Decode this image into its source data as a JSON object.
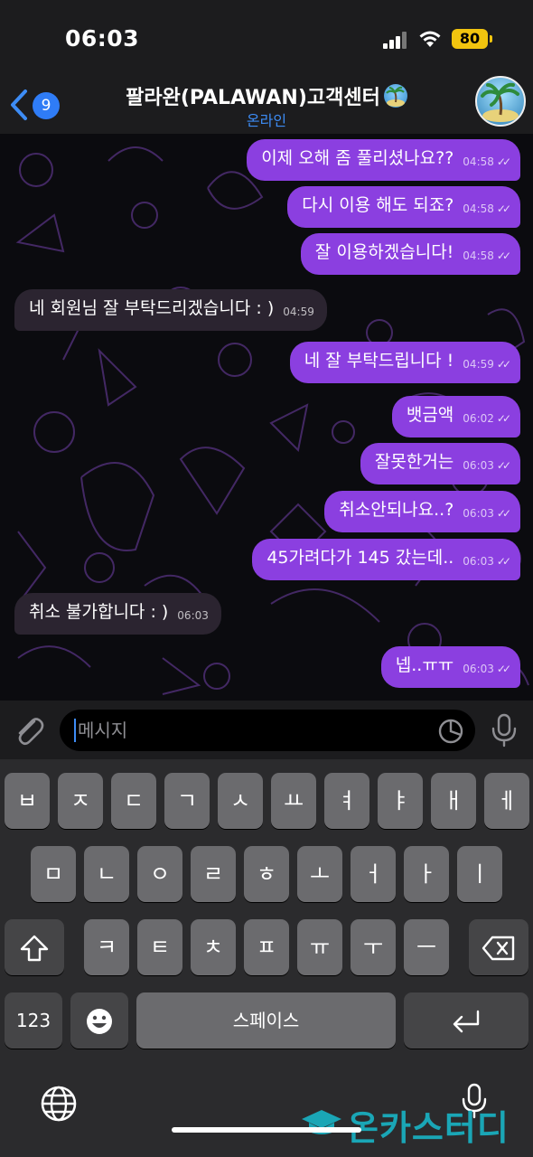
{
  "status_bar": {
    "time": "06:03",
    "battery": "80"
  },
  "header": {
    "back_count": "9",
    "title": "팔라완(PALAWAN)고객센터",
    "status": "온라인"
  },
  "messages": [
    {
      "dir": "out",
      "text": "이제 오해 좀 풀리셨나요??",
      "time": "04:58"
    },
    {
      "dir": "out",
      "text": "다시 이용 해도 되죠?",
      "time": "04:58"
    },
    {
      "dir": "out",
      "text": "잘 이용하겠습니다!",
      "time": "04:58"
    },
    {
      "dir": "in",
      "text": "네 회원님 잘 부탁드리겠습니다 : )",
      "time": "04:59"
    },
    {
      "dir": "out",
      "text": "네 잘 부탁드립니다 !",
      "time": "04:59"
    },
    {
      "dir": "out",
      "text": "뱃금액",
      "time": "06:02"
    },
    {
      "dir": "out",
      "text": "잘못한거는",
      "time": "06:03"
    },
    {
      "dir": "out",
      "text": "취소안되나요..?",
      "time": "06:03"
    },
    {
      "dir": "out",
      "text": "45가려다가 145 갔는데..",
      "time": "06:03"
    },
    {
      "dir": "in",
      "text": "취소 불가합니다 : )",
      "time": "06:03"
    },
    {
      "dir": "out",
      "text": "넵..ㅠㅠ",
      "time": "06:03"
    }
  ],
  "input": {
    "placeholder": "메시지"
  },
  "keyboard": {
    "row1": [
      "ㅂ",
      "ㅈ",
      "ㄷ",
      "ㄱ",
      "ㅅ",
      "ㅛ",
      "ㅕ",
      "ㅑ",
      "ㅐ",
      "ㅔ"
    ],
    "row2": [
      "ㅁ",
      "ㄴ",
      "ㅇ",
      "ㄹ",
      "ㅎ",
      "ㅗ",
      "ㅓ",
      "ㅏ",
      "ㅣ"
    ],
    "row3": [
      "ㅋ",
      "ㅌ",
      "ㅊ",
      "ㅍ",
      "ㅠ",
      "ㅜ",
      "ㅡ"
    ],
    "numbers_key": "123",
    "space_key": "스페이스"
  },
  "watermark": "온카스터디"
}
